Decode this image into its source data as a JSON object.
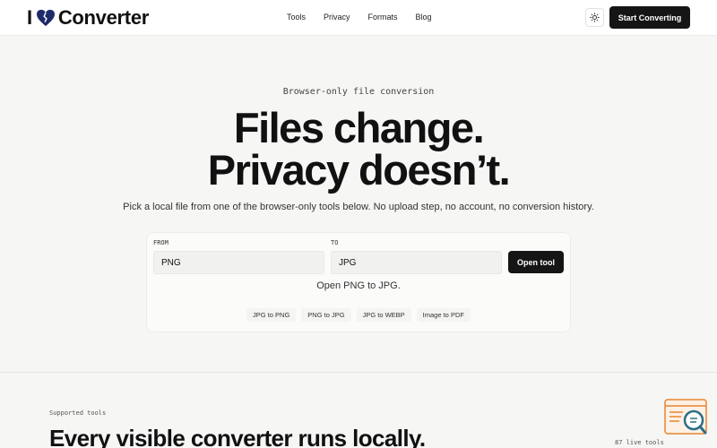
{
  "brand": {
    "prefix": "I",
    "name": "Converter",
    "heart_color": "#1f2a6b"
  },
  "nav": {
    "items": [
      "Tools",
      "Privacy",
      "Formats",
      "Blog"
    ]
  },
  "header": {
    "theme_icon": "sun-icon",
    "cta_label": "Start Converting"
  },
  "hero": {
    "eyebrow": "Browser-only file conversion",
    "headline_line1": "Files change.",
    "headline_line2": "Privacy doesn’t.",
    "subtitle": "Pick a local file from one of the browser-only tools below. No upload step, no account, no conversion history."
  },
  "converter": {
    "from_label": "FROM",
    "to_label": "TO",
    "from_value": "PNG",
    "to_value": "JPG",
    "open_label": "Open tool",
    "status": "Open PNG to JPG.",
    "quick_links": [
      "JPG to PNG",
      "PNG to JPG",
      "JPG to WEBP",
      "Image to PDF"
    ]
  },
  "tools_section": {
    "label": "Supported tools",
    "title": "Every visible converter runs locally.",
    "count": "87 live tools"
  },
  "widget": {
    "icon": "search-widget-icon",
    "accent": "#e8842e",
    "lens_color": "#2d6f86"
  }
}
